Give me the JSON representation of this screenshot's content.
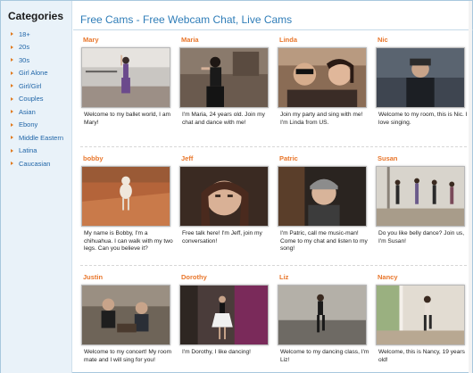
{
  "sidebar": {
    "title": "Categories",
    "items": [
      "18+",
      "20s",
      "30s",
      "Girl Alone",
      "Girl/Girl",
      "Couples",
      "Asian",
      "Ebony",
      "Middle Eastern",
      "Latina",
      "Caucasian"
    ]
  },
  "main": {
    "title": "Free Cams - Free Webcam Chat, Live Cams"
  },
  "cams": [
    {
      "name": "Mary",
      "desc": "Welcome to my ballet world, I am Mary!"
    },
    {
      "name": "Maria",
      "desc": "I'm Maria, 24 years old. Join my chat and dance with me!"
    },
    {
      "name": "Linda",
      "desc": "Join my party and sing with me! I'm Linda from US."
    },
    {
      "name": "Nic",
      "desc": "Welcome to my room, this is Nic. I love singing."
    },
    {
      "name": "bobby",
      "desc": "My name is Bobby, I'm a chihuahua. I can walk with my two legs. Can you believe it?"
    },
    {
      "name": "Jeff",
      "desc": "Free talk here! I'm Jeff, join my conversation!"
    },
    {
      "name": "Patric",
      "desc": "I'm Patric, call me music-man! Come to my chat and listen to my song!"
    },
    {
      "name": "Susan",
      "desc": "Do you like belly dance? Join us, I'm Susan!"
    },
    {
      "name": "Justin",
      "desc": "Welcome to my concert! My room mate and I will sing for you!"
    },
    {
      "name": "Dorothy",
      "desc": "I'm Dorothy, I like dancing!"
    },
    {
      "name": "Liz",
      "desc": "Welcome to my dancing class, I'm Liz!"
    },
    {
      "name": "Nancy",
      "desc": "Welcome, this is Nancy, 19 years old!"
    }
  ],
  "colors": {
    "accent": "#e8762b",
    "title": "#2f7db8",
    "link": "#2166a8",
    "sidebar_bg": "#e9f2f9"
  }
}
